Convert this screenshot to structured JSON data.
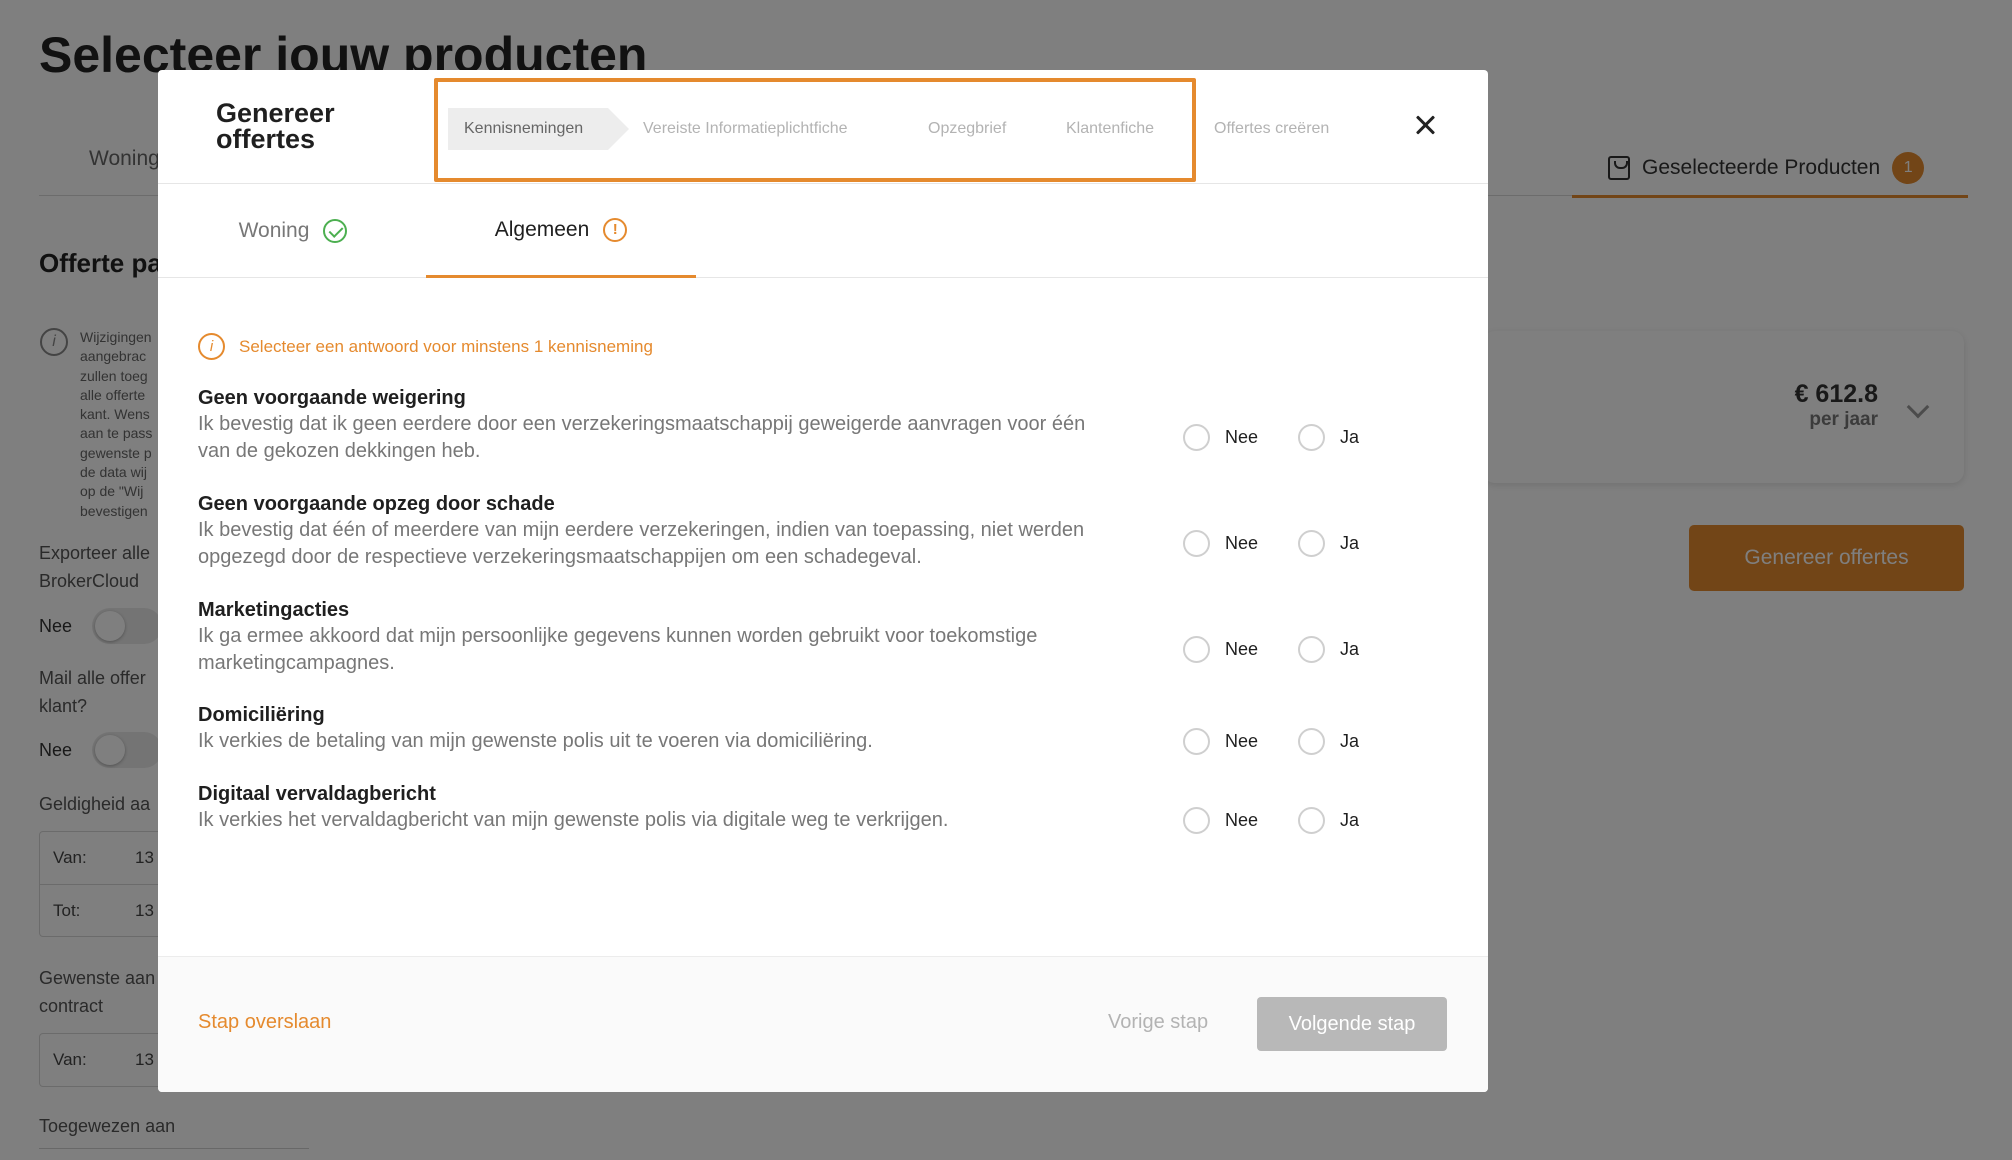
{
  "background": {
    "page_title": "Selecteer jouw producten",
    "tab_woning": "Woning",
    "selected_products_label": "Geselecteerde Producten",
    "selected_products_count": "1",
    "offerte_heading": "Offerte pa",
    "info_text": "Wijzigingen\naangebrac\nzullen toeg\nalle offerte\nkant. Wens\naan te pass\ngewenste p\nde data wij\nop de \"Wij\nbevestigen",
    "export_label": "Exporteer alle\nBrokerCloud",
    "export_toggle_label": "Nee",
    "mail_label": "Mail alle offer\nklant?",
    "mail_toggle_label": "Nee",
    "validity_label": "Geldigheid aa",
    "validity_from_label": "Van:",
    "validity_from_value": "13",
    "validity_to_label": "Tot:",
    "validity_to_value": "13",
    "contract_label": "Gewenste aan\ncontract",
    "contract_from_label": "Van:",
    "contract_from_value": "13",
    "assigned_label": "Toegewezen aan",
    "price_amount": "€ 612.8",
    "price_period": "per jaar",
    "generate_button": "Genereer offertes"
  },
  "modal": {
    "title": "Genereer offertes",
    "steps": [
      {
        "label": "Kennisnemingen",
        "active": true
      },
      {
        "label": "Vereiste Informatieplichtfiche",
        "active": false
      },
      {
        "label": "Opzegbrief",
        "active": false
      },
      {
        "label": "Klantenfiche",
        "active": false
      },
      {
        "label": "Offertes creëren",
        "active": false
      }
    ],
    "tabs": [
      {
        "label": "Woning",
        "status": "complete"
      },
      {
        "label": "Algemeen",
        "status": "warning"
      }
    ],
    "notice": "Selecteer een antwoord voor minstens 1 kennisneming",
    "option_no": "Nee",
    "option_yes": "Ja",
    "questions": [
      {
        "title": "Geen voorgaande weigering",
        "description": "Ik bevestig dat ik geen eerdere door een verzekeringsmaatschappij geweigerde aanvragen voor één van de gekozen dekkingen heb."
      },
      {
        "title": "Geen voorgaande opzeg door schade",
        "description": "Ik bevestig dat één of meerdere van mijn eerdere verzekeringen, indien van toepassing, niet werden opgezegd door de respectieve verzekeringsmaatschappijen om een schadegeval."
      },
      {
        "title": "Marketingacties",
        "description": "Ik ga ermee akkoord dat mijn persoonlijke gegevens kunnen worden gebruikt voor toekomstige marketingcampagnes."
      },
      {
        "title": "Domiciliëring",
        "description": "Ik verkies de betaling van mijn gewenste polis uit te voeren via domiciliëring."
      },
      {
        "title": "Digitaal vervaldagbericht",
        "description": "Ik verkies het vervaldagbericht van mijn gewenste polis via digitale weg te verkrijgen."
      }
    ],
    "footer": {
      "skip": "Stap overslaan",
      "previous": "Vorige stap",
      "next": "Volgende stap"
    }
  },
  "colors": {
    "accent": "#e58a2e",
    "success": "#4caf50",
    "disabled_button": "#b8b8b8"
  }
}
